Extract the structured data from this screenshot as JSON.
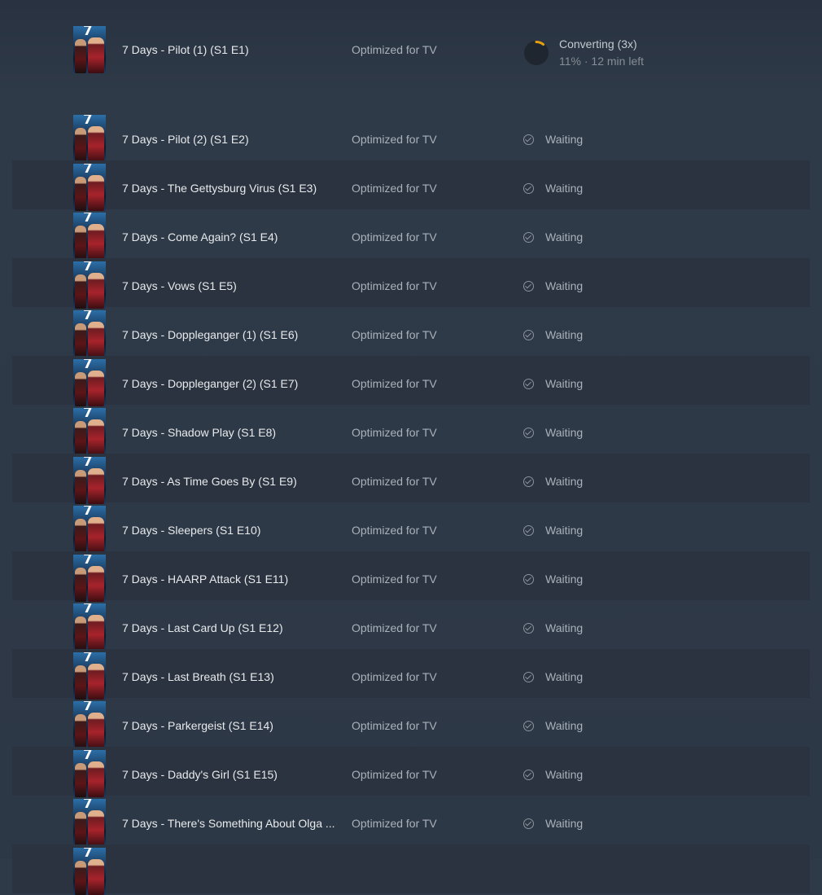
{
  "colors": {
    "background": "#2f3a49",
    "row_alt": "#2a333f",
    "text_primary": "#e8eaec",
    "text_secondary": "#a9b1ba",
    "progress_accent": "#e5a00d"
  },
  "active": {
    "title": "7 Days - Pilot (1) (S1 E1)",
    "profile": "Optimized for TV",
    "status_title": "Converting (3x)",
    "status_detail": "11% · 12 min left",
    "progress": 0.11,
    "thumbnail_icon": "poster-thumbnail"
  },
  "queue": [
    {
      "title": "7 Days - Pilot (2) (S1 E2)",
      "profile": "Optimized for TV",
      "status": "Waiting"
    },
    {
      "title": "7 Days - The Gettysburg Virus (S1 E3)",
      "profile": "Optimized for TV",
      "status": "Waiting"
    },
    {
      "title": "7 Days - Come Again? (S1 E4)",
      "profile": "Optimized for TV",
      "status": "Waiting"
    },
    {
      "title": "7 Days - Vows (S1 E5)",
      "profile": "Optimized for TV",
      "status": "Waiting"
    },
    {
      "title": "7 Days - Doppleganger (1) (S1 E6)",
      "profile": "Optimized for TV",
      "status": "Waiting"
    },
    {
      "title": "7 Days - Doppleganger (2) (S1 E7)",
      "profile": "Optimized for TV",
      "status": "Waiting"
    },
    {
      "title": "7 Days - Shadow Play (S1 E8)",
      "profile": "Optimized for TV",
      "status": "Waiting"
    },
    {
      "title": "7 Days - As Time Goes By (S1 E9)",
      "profile": "Optimized for TV",
      "status": "Waiting"
    },
    {
      "title": "7 Days - Sleepers (S1 E10)",
      "profile": "Optimized for TV",
      "status": "Waiting"
    },
    {
      "title": "7 Days - HAARP Attack (S1 E11)",
      "profile": "Optimized for TV",
      "status": "Waiting"
    },
    {
      "title": "7 Days - Last Card Up (S1 E12)",
      "profile": "Optimized for TV",
      "status": "Waiting"
    },
    {
      "title": "7 Days - Last Breath (S1 E13)",
      "profile": "Optimized for TV",
      "status": "Waiting"
    },
    {
      "title": "7 Days - Parkergeist (S1 E14)",
      "profile": "Optimized for TV",
      "status": "Waiting"
    },
    {
      "title": "7 Days - Daddy's Girl (S1 E15)",
      "profile": "Optimized for TV",
      "status": "Waiting"
    },
    {
      "title": "7 Days - There's Something About Olga ...",
      "profile": "Optimized for TV",
      "status": "Waiting"
    },
    {
      "title": "",
      "profile": "",
      "status": ""
    }
  ],
  "poster_text": "7"
}
